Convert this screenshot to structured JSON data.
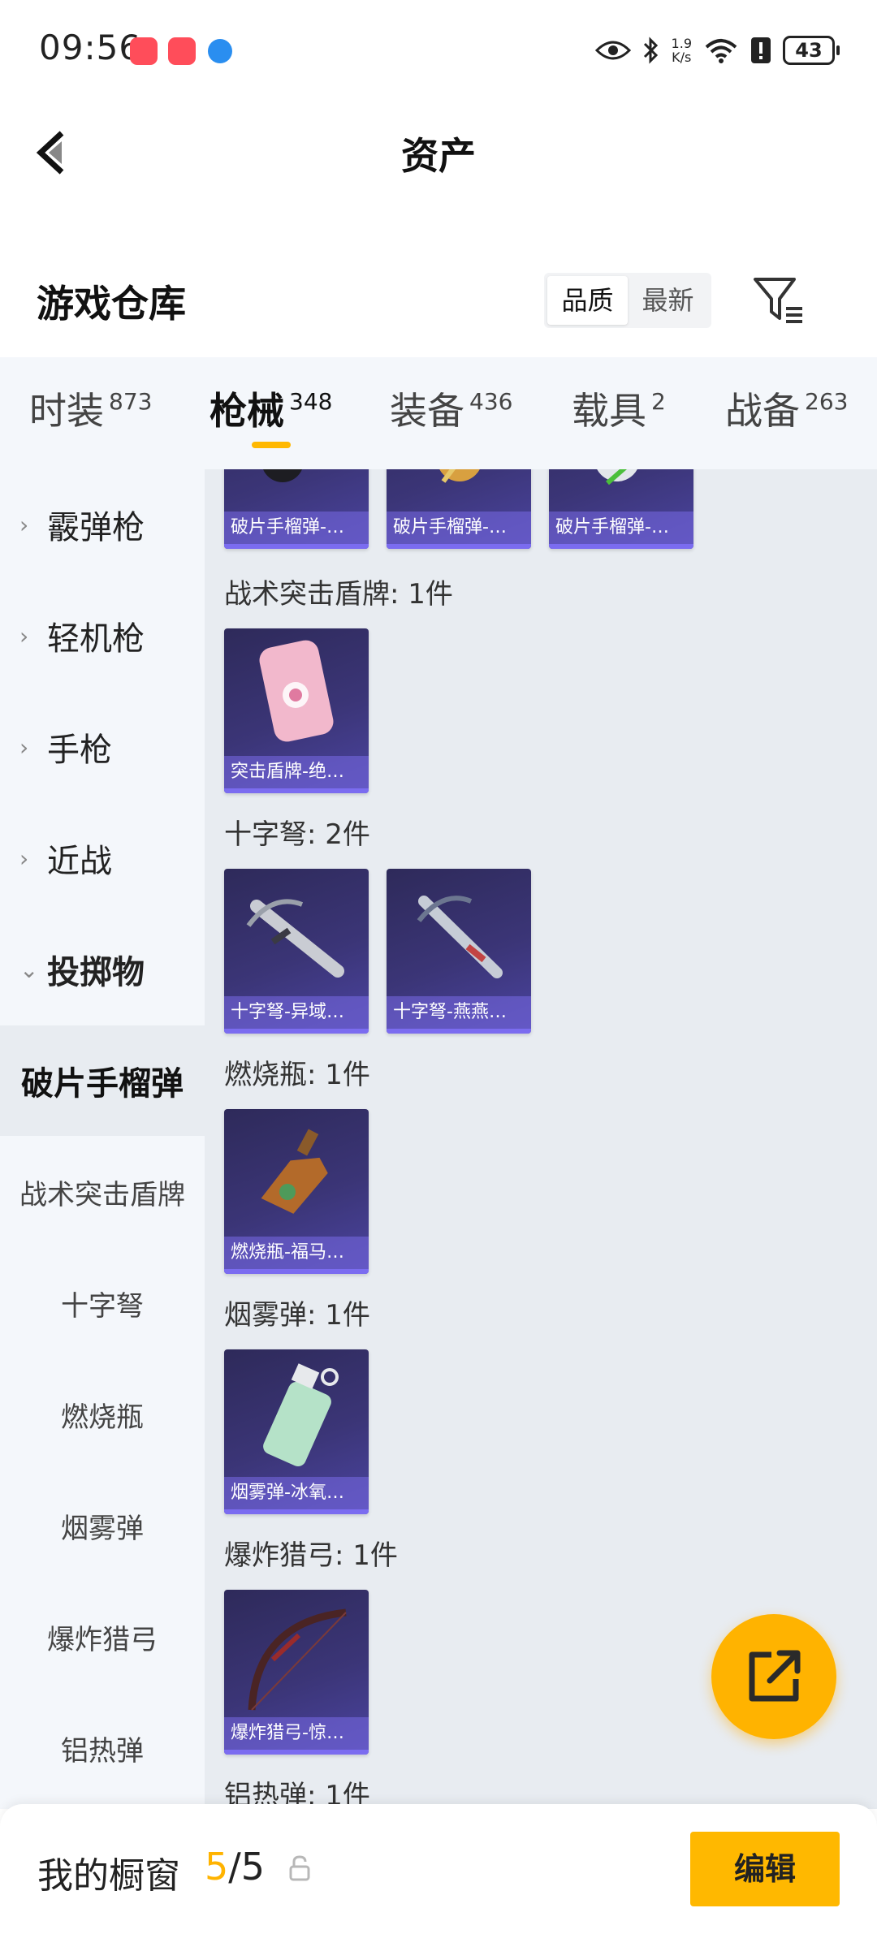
{
  "status_bar": {
    "time": "09:56",
    "net_speed_value": "1.9",
    "net_speed_unit": "K/s",
    "battery": "43"
  },
  "header": {
    "title": "资产"
  },
  "section": {
    "title": "游戏仓库",
    "sort_options": [
      "品质",
      "最新"
    ],
    "sort_selected": "品质"
  },
  "tabs": [
    {
      "label": "时装",
      "count": "873"
    },
    {
      "label": "枪械",
      "count": "348",
      "active": true
    },
    {
      "label": "装备",
      "count": "436"
    },
    {
      "label": "载具",
      "count": "2"
    },
    {
      "label": "战备",
      "count": "263"
    }
  ],
  "sidebar": {
    "categories": [
      "霰弹枪",
      "轻机枪",
      "手枪",
      "近战",
      "投掷物"
    ],
    "expanded": "投掷物",
    "subcategories": [
      "破片手榴弹",
      "战术突击盾牌",
      "十字弩",
      "燃烧瓶",
      "烟雾弹",
      "爆炸猎弓",
      "铝热弹"
    ],
    "selected": "破片手榴弹"
  },
  "content": {
    "groups": [
      {
        "label": "",
        "items": [
          "破片手榴弹-…",
          "破片手榴弹-…",
          "破片手榴弹-…"
        ]
      },
      {
        "label": "战术突击盾牌: 1件",
        "items": [
          "突击盾牌-绝…"
        ]
      },
      {
        "label": "十字弩: 2件",
        "items": [
          "十字弩-异域…",
          "十字弩-燕燕…"
        ]
      },
      {
        "label": "燃烧瓶: 1件",
        "items": [
          "燃烧瓶-福马…"
        ]
      },
      {
        "label": "烟雾弹: 1件",
        "items": [
          "烟雾弹-冰氧…"
        ]
      },
      {
        "label": "爆炸猎弓: 1件",
        "items": [
          "爆炸猎弓-惊…"
        ]
      },
      {
        "label": "铝热弹: 1件",
        "items": []
      }
    ]
  },
  "bottom_bar": {
    "title": "我的橱窗",
    "count_current": "5",
    "count_sep": "/",
    "count_total": "5",
    "edit_label": "编辑"
  },
  "colors": {
    "accent": "#ffb800",
    "card_bg": "#3b3577",
    "sidebar_bg": "#f4f7fb",
    "content_bg": "#e8ecf1"
  }
}
